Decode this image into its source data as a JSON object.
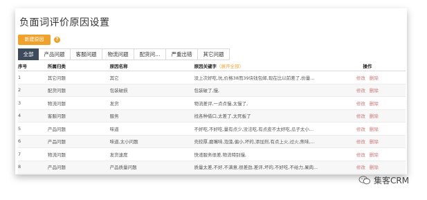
{
  "title": "负面词评价原因设置",
  "new_button": "新建原因",
  "help_icon": "?",
  "tabs": [
    "全部",
    "产品问题",
    "客服问题",
    "物流问题",
    "配货问...",
    "严重出错",
    "其它问题"
  ],
  "columns": {
    "index": "序号",
    "category": "所属归类",
    "name": "原因名称",
    "keywords": "原因关键字",
    "keywords_hint": "（展开全部）",
    "ops": "操作"
  },
  "edit_label": "修改",
  "delete_label": "删除",
  "rows": [
    {
      "index": "1",
      "category": "其它问题",
      "name": "其它",
      "keywords": "没上次好吃,坑,价格38而39块钱包邮,现在比以前差了,份量..."
    },
    {
      "index": "2",
      "category": "配货问题",
      "name": "包装破损",
      "keywords": "包装破了,慢,"
    },
    {
      "index": "3",
      "category": "物流问题",
      "name": "发货",
      "keywords": "物流差评,一点点慢,太慢了,"
    },
    {
      "index": "4",
      "category": "客服问题",
      "name": "服务",
      "keywords": "找各种借口,太差了,太死板了"
    },
    {
      "index": "5",
      "category": "产品问题",
      "name": "味道",
      "keywords": "不好吃,不好吃,量有点少,没法吃,有点皮不太好吃,瓜子太小..."
    },
    {
      "index": "6",
      "category": "产品问题",
      "name": "味道,太小问题",
      "keywords": "壳较厚,磨嘴味,泡藻,偏小,坏的,添加剂,有点上火,过火,焦味,..."
    },
    {
      "index": "7",
      "category": "物流问题",
      "name": "发货速度",
      "keywords": "快递服务很差,物流特别慢,"
    },
    {
      "index": "8",
      "category": "产品问题",
      "name": "产品质量问题",
      "keywords": "质量太差,不好,不满意,很差劲,差评,坏的,不好吃,不给力,果肉..."
    }
  ],
  "watermark": "集客CRM",
  "accent_color": "#f0a12b",
  "active_tab_color": "#3d4a5c"
}
